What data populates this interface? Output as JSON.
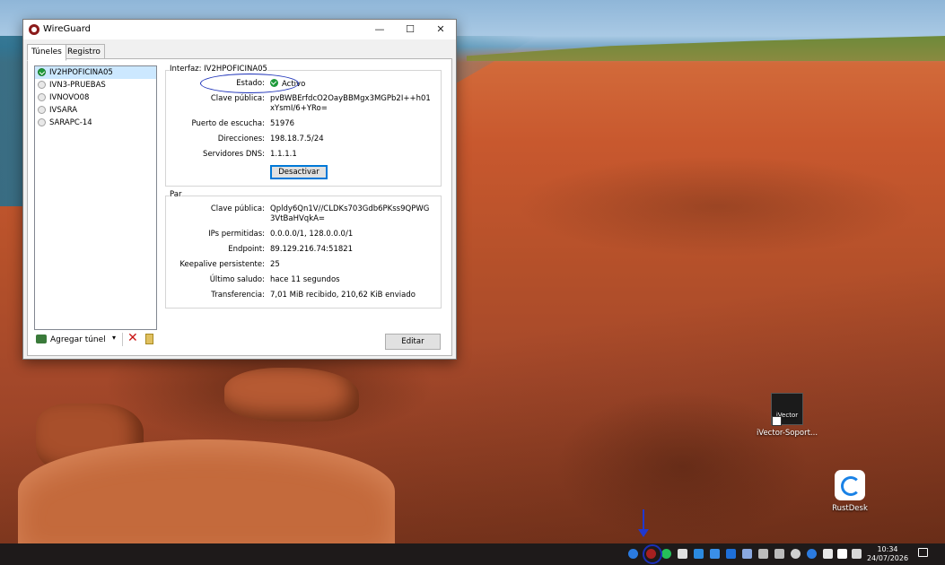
{
  "window": {
    "title": "WireGuard",
    "controls": {
      "minimize": "—",
      "maximize": "☐",
      "close": "✕"
    }
  },
  "tabs": [
    {
      "label": "Túneles",
      "active": true
    },
    {
      "label": "Registro",
      "active": false
    }
  ],
  "tunnels": [
    {
      "name": "IV2HPOFICINA05",
      "active": true
    },
    {
      "name": "IVN3-PRUEBAS",
      "active": false
    },
    {
      "name": "IVNOVO08",
      "active": false
    },
    {
      "name": "IVSARA",
      "active": false
    },
    {
      "name": "SARAPC-14",
      "active": false
    }
  ],
  "toolbar": {
    "add_tunnel": "Agregar túnel",
    "caret": "▾",
    "delete": "✕"
  },
  "interface": {
    "title": "Interfaz: IV2HPOFICINA05",
    "status_label": "Estado:",
    "status_value": "Activo",
    "pubkey_label": "Clave pública:",
    "pubkey_value": "pvBWBErfdcO2OayBBMgx3MGPb2I++h01xYsmI/6+YRo=",
    "port_label": "Puerto de escucha:",
    "port_value": "51976",
    "addresses_label": "Direcciones:",
    "addresses_value": "198.18.7.5/24",
    "dns_label": "Servidores DNS:",
    "dns_value": "1.1.1.1",
    "deactivate_button": "Desactivar"
  },
  "peer": {
    "title": "Par",
    "pubkey_label": "Clave pública:",
    "pubkey_value": "Qpldy6Qn1V//CLDKs703Gdb6PKss9QPWG3VtBaHVqkA=",
    "allowed_ips_label": "IPs permitidas:",
    "allowed_ips_value": "0.0.0.0/1, 128.0.0.0/1",
    "endpoint_label": "Endpoint:",
    "endpoint_value": "89.129.216.74:51821",
    "keepalive_label": "Keepalive persistente:",
    "keepalive_value": "25",
    "handshake_label": "Último saludo:",
    "handshake_value": "hace 11 segundos",
    "transfer_label": "Transferencia:",
    "transfer_value": "7,01 MiB recibido, 210,62 KiB enviado"
  },
  "edit_button": "Editar",
  "desktop_icons": [
    {
      "label": "iVector-Soport...",
      "badge": "iVector"
    },
    {
      "label": "RustDesk"
    }
  ],
  "taskbar": {
    "time": "10:34",
    "date": "24/07/2026"
  },
  "colors": {
    "active_green": "#1e9a3a",
    "annotation_blue": "#1a2fb8",
    "selection": "#cce8ff"
  }
}
